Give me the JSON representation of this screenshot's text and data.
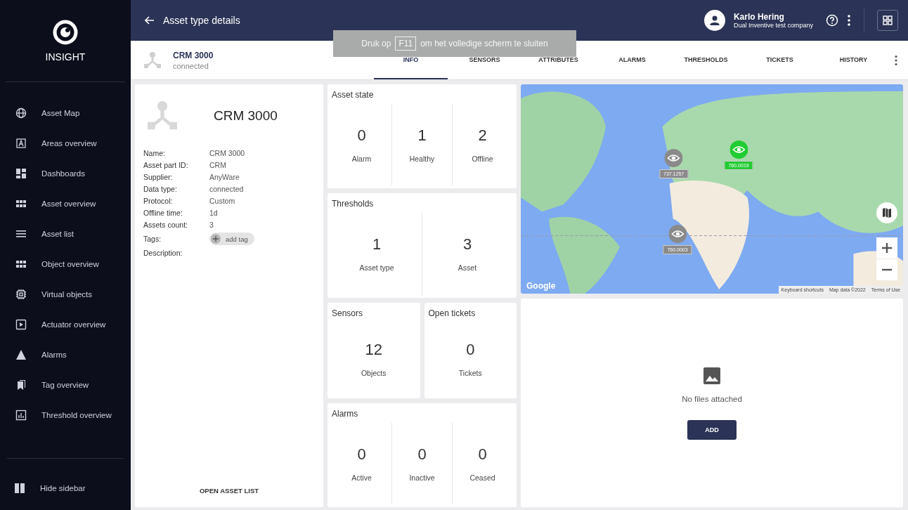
{
  "sidebar": {
    "brand": "INSIGHT",
    "items": [
      {
        "label": "Asset Map",
        "selected": false
      },
      {
        "label": "Areas overview",
        "selected": false
      },
      {
        "label": "Dashboards",
        "selected": false
      },
      {
        "label": "Asset overview",
        "selected": false
      },
      {
        "label": "Asset list",
        "selected": false
      },
      {
        "label": "Object overview",
        "selected": false
      },
      {
        "label": "Virtual objects",
        "selected": false
      },
      {
        "label": "Actuator overview",
        "selected": false
      },
      {
        "label": "Alarms",
        "selected": false
      },
      {
        "label": "Tag overview",
        "selected": false
      },
      {
        "label": "Threshold overview",
        "selected": false
      }
    ],
    "footer": "Hide sidebar"
  },
  "header": {
    "title": "Asset type details",
    "user_name": "Karlo Hering",
    "company": "Dual Inventive test company"
  },
  "fullscreen_notice": {
    "before": "Druk op",
    "key": "F11",
    "after": "om het volledige scherm te sluiten"
  },
  "asset": {
    "name": "CRM 3000",
    "status": "connected"
  },
  "tabs": [
    {
      "label": "INFO",
      "selected": true
    },
    {
      "label": "SENSORS",
      "selected": false
    },
    {
      "label": "ATTRIBUTES",
      "selected": false
    },
    {
      "label": "ALARMS",
      "selected": false
    },
    {
      "label": "THRESHOLDS",
      "selected": false
    },
    {
      "label": "TICKETS",
      "selected": false
    },
    {
      "label": "HISTORY",
      "selected": false
    }
  ],
  "details": {
    "title": "CRM 3000",
    "fields": [
      {
        "label": "Name:",
        "value": "CRM 3000"
      },
      {
        "label": "Asset part ID:",
        "value": "CRM"
      },
      {
        "label": "Supplier:",
        "value": "AnyWare"
      },
      {
        "label": "Data type:",
        "value": "connected"
      },
      {
        "label": "Protocol:",
        "value": "Custom"
      },
      {
        "label": "Offline time:",
        "value": "1d"
      },
      {
        "label": "Assets count:",
        "value": "3"
      }
    ],
    "tags_label": "Tags:",
    "add_tag": "add tag",
    "description_label": "Description:",
    "open_button": "OPEN ASSET LIST"
  },
  "panels": [
    {
      "title": "Asset state",
      "kind": "full",
      "stats": [
        {
          "value": "0",
          "label": "Alarm"
        },
        {
          "value": "1",
          "label": "Healthy"
        },
        {
          "value": "2",
          "label": "Offline"
        }
      ]
    },
    {
      "title": "Thresholds",
      "kind": "full",
      "stats": [
        {
          "value": "1",
          "label": "Asset type"
        },
        {
          "value": "3",
          "label": "Asset"
        }
      ]
    },
    {
      "title": "Sensors",
      "kind": "half",
      "stats": [
        {
          "value": "12",
          "label": "Objects"
        }
      ]
    },
    {
      "title": "Open tickets",
      "kind": "half",
      "stats": [
        {
          "value": "0",
          "label": "Tickets"
        }
      ]
    },
    {
      "title": "Alarms",
      "kind": "full",
      "stats": [
        {
          "value": "0",
          "label": "Active"
        },
        {
          "value": "0",
          "label": "Inactive"
        },
        {
          "value": "0",
          "label": "Ceased"
        }
      ]
    }
  ],
  "map": {
    "logo": "Google",
    "markers": [
      {
        "label": "737.1257",
        "color": "#8a8a8a"
      },
      {
        "label": "760.0019",
        "color": "#22cc33"
      },
      {
        "label": "760.0003",
        "color": "#8a8a8a"
      }
    ],
    "attribution": [
      "Keyboard shortcuts",
      "Map data ©2022",
      "Terms of Use"
    ]
  },
  "files": {
    "empty_text": "No files attached",
    "add_button": "ADD"
  }
}
